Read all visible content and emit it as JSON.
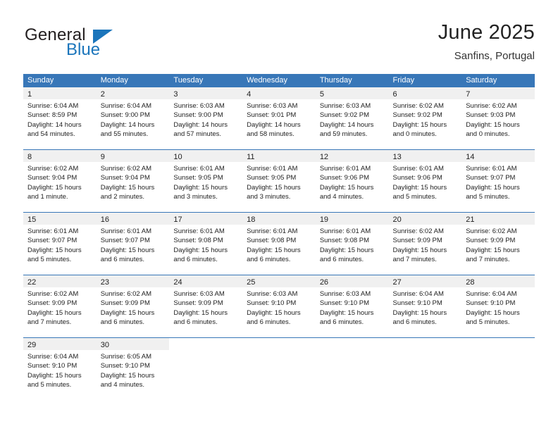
{
  "logo": {
    "primary_text": "General",
    "secondary_text": "Blue",
    "accent_color": "#1b75bb",
    "triangle_icon": "logo-triangle-icon"
  },
  "header": {
    "title": "June 2025",
    "subtitle": "Sanfins, Portugal"
  },
  "theme": {
    "header_blue": "#3877b8",
    "daynum_band": "#f0f0f0",
    "text": "#222222"
  },
  "calendar": {
    "weekday_headers": [
      "Sunday",
      "Monday",
      "Tuesday",
      "Wednesday",
      "Thursday",
      "Friday",
      "Saturday"
    ],
    "weeks": [
      [
        {
          "day": "1",
          "sunrise": "Sunrise: 6:04 AM",
          "sunset": "Sunset: 8:59 PM",
          "daylight_1": "Daylight: 14 hours",
          "daylight_2": "and 54 minutes."
        },
        {
          "day": "2",
          "sunrise": "Sunrise: 6:04 AM",
          "sunset": "Sunset: 9:00 PM",
          "daylight_1": "Daylight: 14 hours",
          "daylight_2": "and 55 minutes."
        },
        {
          "day": "3",
          "sunrise": "Sunrise: 6:03 AM",
          "sunset": "Sunset: 9:00 PM",
          "daylight_1": "Daylight: 14 hours",
          "daylight_2": "and 57 minutes."
        },
        {
          "day": "4",
          "sunrise": "Sunrise: 6:03 AM",
          "sunset": "Sunset: 9:01 PM",
          "daylight_1": "Daylight: 14 hours",
          "daylight_2": "and 58 minutes."
        },
        {
          "day": "5",
          "sunrise": "Sunrise: 6:03 AM",
          "sunset": "Sunset: 9:02 PM",
          "daylight_1": "Daylight: 14 hours",
          "daylight_2": "and 59 minutes."
        },
        {
          "day": "6",
          "sunrise": "Sunrise: 6:02 AM",
          "sunset": "Sunset: 9:02 PM",
          "daylight_1": "Daylight: 15 hours",
          "daylight_2": "and 0 minutes."
        },
        {
          "day": "7",
          "sunrise": "Sunrise: 6:02 AM",
          "sunset": "Sunset: 9:03 PM",
          "daylight_1": "Daylight: 15 hours",
          "daylight_2": "and 0 minutes."
        }
      ],
      [
        {
          "day": "8",
          "sunrise": "Sunrise: 6:02 AM",
          "sunset": "Sunset: 9:04 PM",
          "daylight_1": "Daylight: 15 hours",
          "daylight_2": "and 1 minute."
        },
        {
          "day": "9",
          "sunrise": "Sunrise: 6:02 AM",
          "sunset": "Sunset: 9:04 PM",
          "daylight_1": "Daylight: 15 hours",
          "daylight_2": "and 2 minutes."
        },
        {
          "day": "10",
          "sunrise": "Sunrise: 6:01 AM",
          "sunset": "Sunset: 9:05 PM",
          "daylight_1": "Daylight: 15 hours",
          "daylight_2": "and 3 minutes."
        },
        {
          "day": "11",
          "sunrise": "Sunrise: 6:01 AM",
          "sunset": "Sunset: 9:05 PM",
          "daylight_1": "Daylight: 15 hours",
          "daylight_2": "and 3 minutes."
        },
        {
          "day": "12",
          "sunrise": "Sunrise: 6:01 AM",
          "sunset": "Sunset: 9:06 PM",
          "daylight_1": "Daylight: 15 hours",
          "daylight_2": "and 4 minutes."
        },
        {
          "day": "13",
          "sunrise": "Sunrise: 6:01 AM",
          "sunset": "Sunset: 9:06 PM",
          "daylight_1": "Daylight: 15 hours",
          "daylight_2": "and 5 minutes."
        },
        {
          "day": "14",
          "sunrise": "Sunrise: 6:01 AM",
          "sunset": "Sunset: 9:07 PM",
          "daylight_1": "Daylight: 15 hours",
          "daylight_2": "and 5 minutes."
        }
      ],
      [
        {
          "day": "15",
          "sunrise": "Sunrise: 6:01 AM",
          "sunset": "Sunset: 9:07 PM",
          "daylight_1": "Daylight: 15 hours",
          "daylight_2": "and 5 minutes."
        },
        {
          "day": "16",
          "sunrise": "Sunrise: 6:01 AM",
          "sunset": "Sunset: 9:07 PM",
          "daylight_1": "Daylight: 15 hours",
          "daylight_2": "and 6 minutes."
        },
        {
          "day": "17",
          "sunrise": "Sunrise: 6:01 AM",
          "sunset": "Sunset: 9:08 PM",
          "daylight_1": "Daylight: 15 hours",
          "daylight_2": "and 6 minutes."
        },
        {
          "day": "18",
          "sunrise": "Sunrise: 6:01 AM",
          "sunset": "Sunset: 9:08 PM",
          "daylight_1": "Daylight: 15 hours",
          "daylight_2": "and 6 minutes."
        },
        {
          "day": "19",
          "sunrise": "Sunrise: 6:01 AM",
          "sunset": "Sunset: 9:08 PM",
          "daylight_1": "Daylight: 15 hours",
          "daylight_2": "and 6 minutes."
        },
        {
          "day": "20",
          "sunrise": "Sunrise: 6:02 AM",
          "sunset": "Sunset: 9:09 PM",
          "daylight_1": "Daylight: 15 hours",
          "daylight_2": "and 7 minutes."
        },
        {
          "day": "21",
          "sunrise": "Sunrise: 6:02 AM",
          "sunset": "Sunset: 9:09 PM",
          "daylight_1": "Daylight: 15 hours",
          "daylight_2": "and 7 minutes."
        }
      ],
      [
        {
          "day": "22",
          "sunrise": "Sunrise: 6:02 AM",
          "sunset": "Sunset: 9:09 PM",
          "daylight_1": "Daylight: 15 hours",
          "daylight_2": "and 7 minutes."
        },
        {
          "day": "23",
          "sunrise": "Sunrise: 6:02 AM",
          "sunset": "Sunset: 9:09 PM",
          "daylight_1": "Daylight: 15 hours",
          "daylight_2": "and 6 minutes."
        },
        {
          "day": "24",
          "sunrise": "Sunrise: 6:03 AM",
          "sunset": "Sunset: 9:09 PM",
          "daylight_1": "Daylight: 15 hours",
          "daylight_2": "and 6 minutes."
        },
        {
          "day": "25",
          "sunrise": "Sunrise: 6:03 AM",
          "sunset": "Sunset: 9:10 PM",
          "daylight_1": "Daylight: 15 hours",
          "daylight_2": "and 6 minutes."
        },
        {
          "day": "26",
          "sunrise": "Sunrise: 6:03 AM",
          "sunset": "Sunset: 9:10 PM",
          "daylight_1": "Daylight: 15 hours",
          "daylight_2": "and 6 minutes."
        },
        {
          "day": "27",
          "sunrise": "Sunrise: 6:04 AM",
          "sunset": "Sunset: 9:10 PM",
          "daylight_1": "Daylight: 15 hours",
          "daylight_2": "and 6 minutes."
        },
        {
          "day": "28",
          "sunrise": "Sunrise: 6:04 AM",
          "sunset": "Sunset: 9:10 PM",
          "daylight_1": "Daylight: 15 hours",
          "daylight_2": "and 5 minutes."
        }
      ],
      [
        {
          "day": "29",
          "sunrise": "Sunrise: 6:04 AM",
          "sunset": "Sunset: 9:10 PM",
          "daylight_1": "Daylight: 15 hours",
          "daylight_2": "and 5 minutes."
        },
        {
          "day": "30",
          "sunrise": "Sunrise: 6:05 AM",
          "sunset": "Sunset: 9:10 PM",
          "daylight_1": "Daylight: 15 hours",
          "daylight_2": "and 4 minutes."
        },
        {
          "day": "",
          "sunrise": "",
          "sunset": "",
          "daylight_1": "",
          "daylight_2": ""
        },
        {
          "day": "",
          "sunrise": "",
          "sunset": "",
          "daylight_1": "",
          "daylight_2": ""
        },
        {
          "day": "",
          "sunrise": "",
          "sunset": "",
          "daylight_1": "",
          "daylight_2": ""
        },
        {
          "day": "",
          "sunrise": "",
          "sunset": "",
          "daylight_1": "",
          "daylight_2": ""
        },
        {
          "day": "",
          "sunrise": "",
          "sunset": "",
          "daylight_1": "",
          "daylight_2": ""
        }
      ]
    ]
  }
}
